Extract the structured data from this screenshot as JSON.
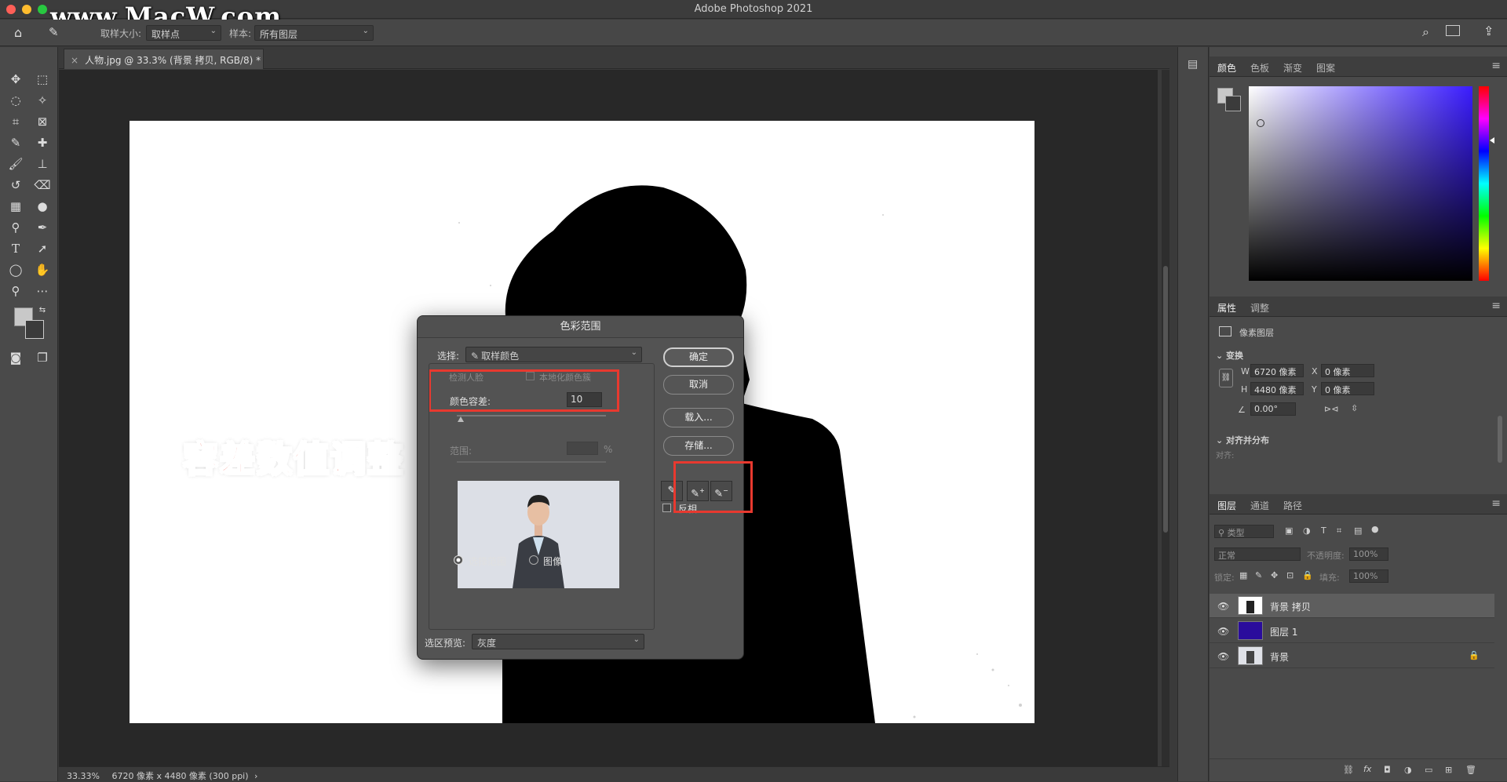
{
  "app": {
    "title": "Adobe Photoshop 2021",
    "watermark": "www.MacW.com"
  },
  "options_bar": {
    "sample_size_label": "取样大小:",
    "sample_size_value": "取样点",
    "sample_label": "样本:",
    "sample_value": "所有图层"
  },
  "document": {
    "tab_label": "人物.jpg @ 33.3% (背景 拷贝, RGB/8) *",
    "zoom": "33.33%",
    "info": "6720 像素 x 4480 像素 (300 ppi)",
    "info_arrow": "›"
  },
  "annotation": {
    "big_label": "容差数值调整"
  },
  "dialog": {
    "title": "色彩范围",
    "select_label": "选择:",
    "select_value": "取样颜色",
    "detect_faces": "检测人脸",
    "localized": "本地化颜色簇",
    "fuzziness_label": "颜色容差:",
    "fuzziness_value": "10",
    "range_label": "范围:",
    "range_unit": "%",
    "radio_selection": "选择范围",
    "radio_image": "图像",
    "preview_label": "选区预览:",
    "preview_value": "灰度",
    "btn_ok": "确定",
    "btn_cancel": "取消",
    "btn_load": "载入...",
    "btn_save": "存储...",
    "invert_label": "反相"
  },
  "color_panel": {
    "tabs": [
      "颜色",
      "色板",
      "渐变",
      "图案"
    ]
  },
  "properties_panel": {
    "tabs": [
      "属性",
      "调整"
    ],
    "layer_type": "像素图层",
    "transform_header": "变换",
    "w_label": "W",
    "w_value": "6720 像素",
    "h_label": "H",
    "h_value": "4480 像素",
    "x_label": "X",
    "x_value": "0 像素",
    "y_label": "Y",
    "y_value": "0 像素",
    "angle_value": "0.00°",
    "align_header": "对齐并分布",
    "align_sub": "对齐:"
  },
  "layers_panel": {
    "tabs": [
      "图层",
      "通道",
      "路径"
    ],
    "filter_label": "类型",
    "blend_mode": "正常",
    "opacity_label": "不透明度:",
    "opacity_value": "100%",
    "lock_label": "锁定:",
    "fill_label": "填充:",
    "fill_value": "100%",
    "layers": [
      {
        "name": "背景 拷贝"
      },
      {
        "name": "图层 1"
      },
      {
        "name": "背景"
      }
    ]
  },
  "colors": {
    "accent_red": "#e8392f",
    "layer1_fill": "#2a0c9c",
    "hue_base": "#3a1cff"
  }
}
